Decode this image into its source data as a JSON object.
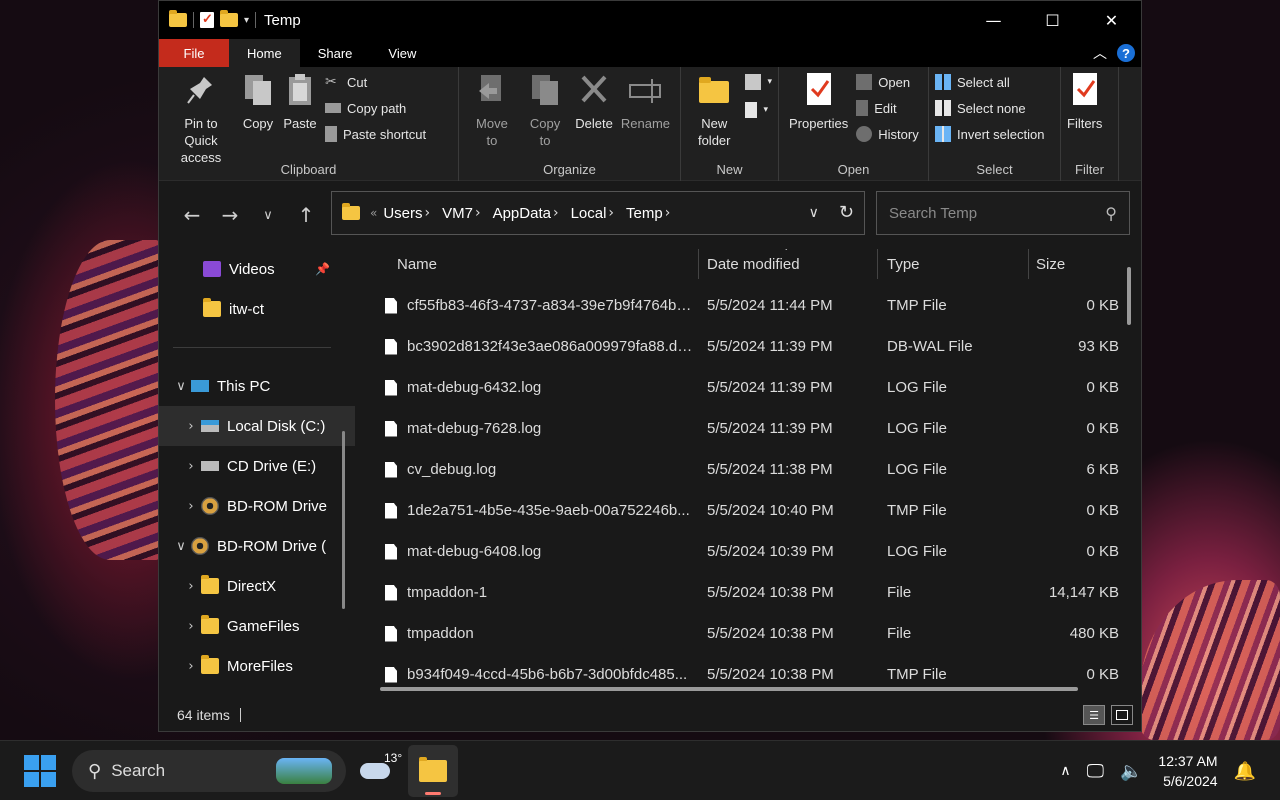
{
  "window": {
    "title": "Temp",
    "controls": {
      "minimize": "—",
      "maximize": "☐",
      "close": "✕"
    }
  },
  "ribbon_tabs": [
    "File",
    "Home",
    "Share",
    "View"
  ],
  "ribbon": {
    "clipboard": {
      "label": "Clipboard",
      "pin": "Pin to Quick access",
      "copy": "Copy",
      "paste": "Paste",
      "cut": "Cut",
      "copy_path": "Copy path",
      "paste_shortcut": "Paste shortcut"
    },
    "organize": {
      "label": "Organize",
      "move_to": "Move to",
      "copy_to": "Copy to",
      "delete": "Delete",
      "rename": "Rename"
    },
    "new": {
      "label": "New",
      "new_folder": "New folder"
    },
    "open": {
      "label": "Open",
      "properties": "Properties",
      "open": "Open",
      "edit": "Edit",
      "history": "History"
    },
    "select": {
      "label": "Select",
      "select_all": "Select all",
      "select_none": "Select none",
      "invert": "Invert selection"
    },
    "filter": {
      "label": "Filter",
      "filters": "Filters"
    }
  },
  "address": {
    "crumbs": [
      "Users",
      "VM7",
      "AppData",
      "Local",
      "Temp"
    ],
    "overflow": "«"
  },
  "search": {
    "placeholder": "Search Temp"
  },
  "sidebar": {
    "quick": [
      {
        "label": "Videos",
        "icon": "video-icon",
        "pinned": true
      },
      {
        "label": "itw-ct",
        "icon": "folder-icon"
      }
    ],
    "this_pc": "This PC",
    "drives": [
      {
        "label": "Local Disk (C:)",
        "icon": "drive-icon",
        "selected": true
      },
      {
        "label": "CD Drive (E:)",
        "icon": "cd-drive-icon"
      },
      {
        "label": "BD-ROM Drive",
        "icon": "bd-rom-icon"
      }
    ],
    "expanded_drive": "BD-ROM Drive (",
    "folders": [
      "DirectX",
      "GameFiles",
      "MoreFiles"
    ]
  },
  "columns": {
    "name": "Name",
    "date": "Date modified",
    "type": "Type",
    "size": "Size"
  },
  "files": [
    {
      "name": "cf55fb83-46f3-4737-a834-39e7b9f4764b....",
      "date": "5/5/2024 11:44 PM",
      "type": "TMP File",
      "size": "0 KB"
    },
    {
      "name": "bc3902d8132f43e3ae086a009979fa88.db...",
      "date": "5/5/2024 11:39 PM",
      "type": "DB-WAL File",
      "size": "93 KB"
    },
    {
      "name": "mat-debug-6432.log",
      "date": "5/5/2024 11:39 PM",
      "type": "LOG File",
      "size": "0 KB"
    },
    {
      "name": "mat-debug-7628.log",
      "date": "5/5/2024 11:39 PM",
      "type": "LOG File",
      "size": "0 KB"
    },
    {
      "name": "cv_debug.log",
      "date": "5/5/2024 11:38 PM",
      "type": "LOG File",
      "size": "6 KB"
    },
    {
      "name": "1de2a751-4b5e-435e-9aeb-00a752246b...",
      "date": "5/5/2024 10:40 PM",
      "type": "TMP File",
      "size": "0 KB"
    },
    {
      "name": "mat-debug-6408.log",
      "date": "5/5/2024 10:39 PM",
      "type": "LOG File",
      "size": "0 KB"
    },
    {
      "name": "tmpaddon-1",
      "date": "5/5/2024 10:38 PM",
      "type": "File",
      "size": "14,147 KB"
    },
    {
      "name": "tmpaddon",
      "date": "5/5/2024 10:38 PM",
      "type": "File",
      "size": "480 KB"
    },
    {
      "name": "b934f049-4ccd-45b6-b6b7-3d00bfdc485...",
      "date": "5/5/2024 10:38 PM",
      "type": "TMP File",
      "size": "0 KB"
    }
  ],
  "status": {
    "items": "64 items"
  },
  "taskbar": {
    "search": "Search",
    "temperature": "13°",
    "time": "12:37 AM",
    "date": "5/6/2024"
  },
  "colors": {
    "file_tab": "#c42b1c",
    "accent": "#1a6fd6",
    "folder": "#f5c542"
  }
}
